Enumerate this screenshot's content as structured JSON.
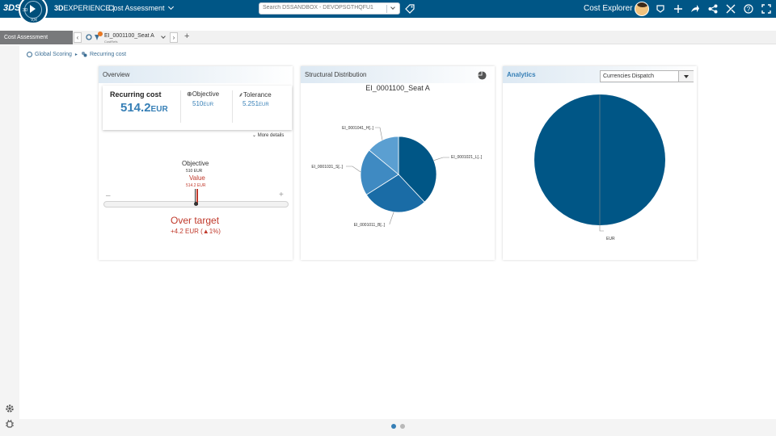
{
  "topbar": {
    "logo_text": "3DS",
    "compass_top": "3D",
    "compass_bottom": "V,R",
    "brand_bold": "3D",
    "brand_rest": "EXPERIENCE",
    "separator": "|",
    "app_title": "Cost Assessment",
    "search_placeholder": "Search DSSANDBOX - DEVOPSGTHQFU1",
    "user_app": "Cost Explorer",
    "icons": [
      "tag-icon",
      "share-icon",
      "add-icon",
      "forward-icon",
      "network-icon",
      "tools-icon",
      "help-icon",
      "fullscreen-icon"
    ]
  },
  "tabs": {
    "active_tab": "Cost Assessment",
    "object_tab_label": "EI_0001100_Seat A",
    "object_tab_sub": "CostRefs",
    "nav_left": "‹",
    "nav_right": "›",
    "add": "+"
  },
  "breadcrumb": {
    "items": [
      "Global Scoring",
      "Recurring cost"
    ],
    "separator": "▸"
  },
  "overview": {
    "title": "Overview",
    "recurring_label": "Recurring cost",
    "recurring_value": "514.2",
    "recurring_unit": "EUR",
    "objective_label": "Objective",
    "objective_value": "510",
    "objective_unit": "EUR",
    "tolerance_label": "Tolerance",
    "tolerance_value": "5.251",
    "tolerance_unit": "EUR",
    "more_details": "More details",
    "gauge": {
      "objective_label": "Objective",
      "objective_value": "510 EUR",
      "value_label": "Value",
      "value_value": "514.2 EUR",
      "minus": "–",
      "plus": "+"
    },
    "status": "Over target",
    "delta": "+4.2 EUR (▲1%)"
  },
  "structural": {
    "title": "Structural Distribution",
    "chart_title": "EI_0001100_Seat A"
  },
  "analytics": {
    "title": "Analytics",
    "dropdown_value": "Currencies Dispatch"
  },
  "colors": {
    "topbar": "#005686",
    "accent": "#367fb6",
    "over_target": "#c0392b",
    "pie_dark": "#005686",
    "pie_mid": "#1a6ca6",
    "pie_light": "#3f8ac2",
    "pie_lightest": "#5b9fd1"
  },
  "chart_data": [
    {
      "type": "pie",
      "title": "EI_0001100_Seat A",
      "categories": [
        "EI_0001021_L[..]",
        "EI_0001011_B[..]",
        "EI_0001031_S[..]",
        "EI_0001041_H[..]"
      ],
      "values": [
        38,
        28,
        20,
        14
      ]
    },
    {
      "type": "pie",
      "title": "",
      "categories": [
        "EUR"
      ],
      "values": [
        100
      ]
    }
  ],
  "bottom": {
    "icons": [
      "settings-icon",
      "bug-icon"
    ]
  }
}
